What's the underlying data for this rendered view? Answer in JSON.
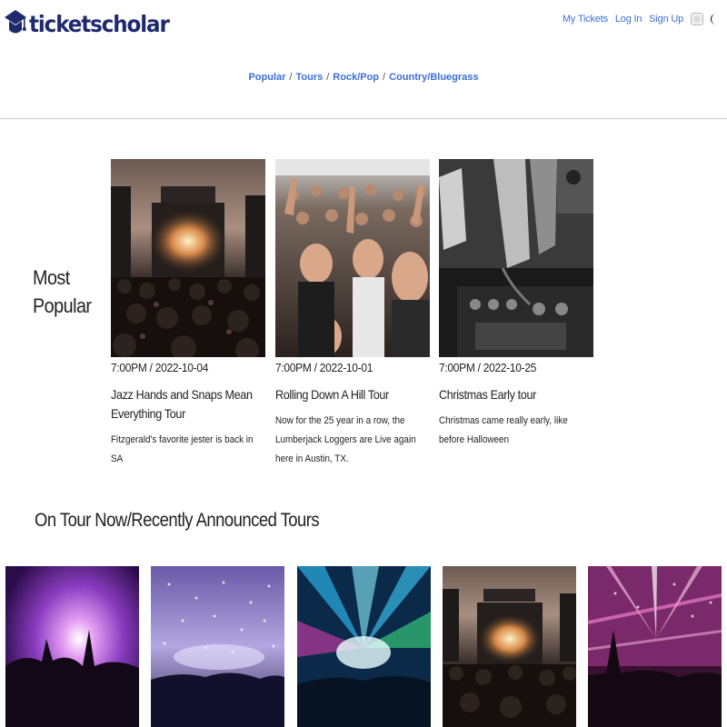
{
  "header": {
    "logo_text": "ticketscholar",
    "logo_icon": "graduation-cap-icon",
    "brand_color": "#1f2a6e",
    "link_color": "#3b6fd6",
    "nav": {
      "my_tickets": "My Tickets",
      "log_in": "Log In",
      "sign_up": "Sign Up"
    },
    "theme_toggle_icon": "toggle-icon",
    "dark_mode_icon": "moon-icon"
  },
  "categories": {
    "items": [
      "Popular",
      "Tours",
      "Rock/Pop",
      "Country/Bluegrass"
    ],
    "separator": "/"
  },
  "most_popular": {
    "title": "Most Popular",
    "cards": [
      {
        "datetime": "7:00PM / 2022-10-04",
        "title": "Jazz Hands and Snaps Mean Everything Tour",
        "description": "Fitzgerald's favorite jester is back in SA",
        "image": "concert-stage-image"
      },
      {
        "datetime": "7:00PM / 2022-10-01",
        "title": "Rolling Down A Hill Tour",
        "description": "Now for the 25 year in a row, the Lumberjack Loggers are Live again here in Austin, TX.",
        "image": "crowd-cheering-image"
      },
      {
        "datetime": "7:00PM / 2022-10-25",
        "title": "Christmas Early tour",
        "description": "Christmas came really early, like before Halloween",
        "image": "dj-mixer-image"
      }
    ]
  },
  "tours": {
    "title": "On Tour Now/Recently Announced Tours",
    "images": [
      "purple-concert-image",
      "confetti-concert-image",
      "rainbow-lights-concert-image",
      "stage-sunset-image",
      "pink-lasers-concert-image"
    ]
  }
}
